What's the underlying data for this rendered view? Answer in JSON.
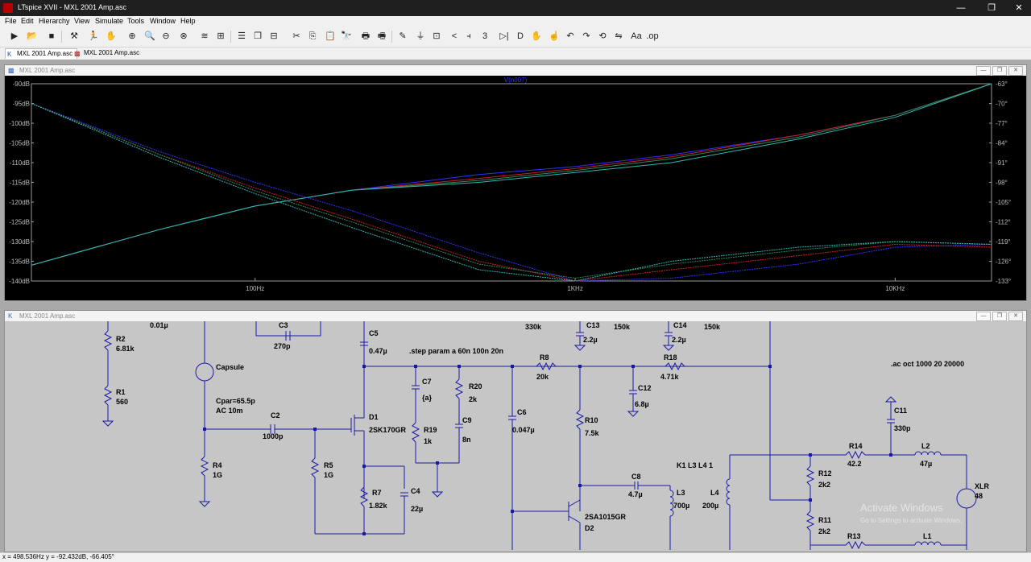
{
  "window": {
    "title": "LTspice XVII - MXL 2001 Amp.asc",
    "minimize": "—",
    "maximize": "❐",
    "close": "✕"
  },
  "menu": [
    "File",
    "Edit",
    "Hierarchy",
    "View",
    "Simulate",
    "Tools",
    "Window",
    "Help"
  ],
  "tabs": [
    {
      "label": "MXL 2001 Amp.asc",
      "icon": "schematic-icon"
    },
    {
      "label": "MXL 2001 Amp.asc",
      "icon": "waveform-icon"
    }
  ],
  "plot": {
    "window_title": "MXL 2001 Amp.asc",
    "trace_label": "V(n007)",
    "trace_color": "#3030ff",
    "left_ticks": [
      "-90dB",
      "-95dB",
      "-100dB",
      "-105dB",
      "-110dB",
      "-115dB",
      "-120dB",
      "-125dB",
      "-130dB",
      "-135dB",
      "-140dB"
    ],
    "right_ticks": [
      "-63°",
      "-70°",
      "-77°",
      "-84°",
      "-91°",
      "-98°",
      "-105°",
      "-112°",
      "-119°",
      "-126°",
      "-133°"
    ],
    "x_ticks": [
      "100Hz",
      "1KHz",
      "10KHz"
    ],
    "series_colors": [
      "#3030ff",
      "#cc2020",
      "#2e8b57",
      "#2fb7b7"
    ]
  },
  "chart_data": {
    "type": "line",
    "title": "V(n007)",
    "xlabel": "",
    "ylabel": "",
    "x_scale": "log",
    "xlim": [
      20,
      20000
    ],
    "ylim": [
      -140,
      -90
    ],
    "y2lim": [
      -133,
      -63
    ],
    "x": [
      20,
      50,
      100,
      200,
      500,
      1000,
      2000,
      5000,
      10000,
      20000
    ],
    "series": [
      {
        "kind": "magnitude",
        "color": "#3030ff",
        "values": [
          -136,
          -127,
          -121,
          -117,
          -113,
          -111,
          -108,
          -103,
          -98,
          -90
        ]
      },
      {
        "kind": "magnitude",
        "color": "#cc2020",
        "values": [
          -136,
          -127,
          -121,
          -117,
          -114,
          -111.5,
          -108.5,
          -103,
          -98,
          -90
        ]
      },
      {
        "kind": "magnitude",
        "color": "#2e8b57",
        "values": [
          -136,
          -127,
          -121,
          -117,
          -114.5,
          -112,
          -109,
          -103.5,
          -98,
          -90
        ]
      },
      {
        "kind": "magnitude",
        "color": "#2fb7b7",
        "values": [
          -136,
          -127,
          -121,
          -117,
          -115,
          -112.5,
          -110,
          -104,
          -98.5,
          -90
        ]
      },
      {
        "kind": "phase",
        "color": "#3030ff",
        "values": [
          -70,
          -87,
          -98,
          -108,
          -123,
          -133,
          -132,
          -127,
          -121,
          -120
        ]
      },
      {
        "kind": "phase",
        "color": "#cc2020",
        "values": [
          -70,
          -88,
          -100,
          -111,
          -126,
          -133,
          -129,
          -124,
          -120,
          -121
        ]
      },
      {
        "kind": "phase",
        "color": "#2e8b57",
        "values": [
          -70,
          -88,
          -101,
          -112,
          -127,
          -132,
          -127,
          -122,
          -119,
          -120
        ]
      },
      {
        "kind": "phase",
        "color": "#2fb7b7",
        "values": [
          -70,
          -89,
          -102,
          -114,
          -129,
          -133,
          -126,
          -121,
          -119,
          -120
        ]
      }
    ]
  },
  "schematic": {
    "window_title": "MXL 2001 Amp.asc",
    "labels": {
      "r2": "R2",
      "r2v": "6.81k",
      "r1": "R1",
      "r1v": "560",
      "c3": "C3",
      "c3v": "270p",
      "topval": "0.01µ",
      "capsule": "Capsule",
      "cpar": "Cpar=65.5p",
      "ac": "AC 10m",
      "c2": "C2",
      "c2v": "1000p",
      "r4": "R4",
      "r4v": "1G",
      "r5": "R5",
      "r5v": "1G",
      "c5": "C5",
      "c5v": "0.47µ",
      "d1": "D1",
      "d1v": "2SK170GR",
      "step": ".step param a 60n 100n 20n",
      "c7": "C7",
      "c7v": "{a}",
      "r20": "R20",
      "r20v": "2k",
      "r19": "R19",
      "r19v": "1k",
      "c9": "C9",
      "c9v": "8n",
      "r7": "R7",
      "r7v": "1.82k",
      "c4": "C4",
      "c4v": "22µ",
      "c6": "C6",
      "c6v": "0.047µ",
      "r8": "R8",
      "r8v": "20k",
      "v330": "330k",
      "c13": "C13",
      "c13v": "2.2µ",
      "v150a": "150k",
      "c14": "C14",
      "c14v": "2.2µ",
      "v150b": "150k",
      "r18": "R18",
      "r18v": "4.71k",
      "c12": "C12",
      "c12v": "6.8µ",
      "r10": "R10",
      "r10v": "7.5k",
      "c8": "C8",
      "c8v": "4.7µ",
      "l3": "L3",
      "l3v": "700µ",
      "l4": "L4",
      "l4v": "200µ",
      "k1": "K1 L3 L4 1",
      "d2": "D2",
      "d2v": "2SA1015GR",
      "acoct": ".ac oct 1000 20 20000",
      "c11": "C11",
      "c11v": "330p",
      "r14": "R14",
      "r14v": "42.2",
      "l2": "L2",
      "l2v": "47µ",
      "r12": "R12",
      "r12v": "2k2",
      "r11": "R11",
      "r11v": "2k2",
      "r13": "R13",
      "l1": "L1",
      "xlr": "XLR",
      "xlrv": "48"
    },
    "watermark_title": "Activate Windows",
    "watermark_sub": "Go to Settings to activate Windows."
  },
  "status": "x = 498.536Hz    y = -92.432dB, -66.405°"
}
